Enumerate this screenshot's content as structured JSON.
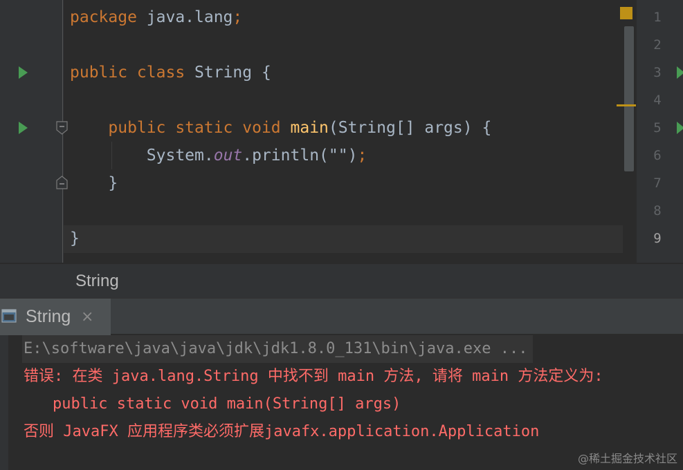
{
  "editor": {
    "lines": [
      {
        "tokens": [
          {
            "t": "package ",
            "c": "kw"
          },
          {
            "t": "java.lang",
            "c": "pl"
          },
          {
            "t": ";",
            "c": "kw"
          }
        ]
      },
      {
        "tokens": []
      },
      {
        "tokens": [
          {
            "t": "public class ",
            "c": "kw"
          },
          {
            "t": "String {",
            "c": "pl"
          }
        ]
      },
      {
        "tokens": []
      },
      {
        "tokens": [
          {
            "t": "    public static void ",
            "c": "kw"
          },
          {
            "t": "main",
            "c": "fn"
          },
          {
            "t": "(String[] args) {",
            "c": "pl"
          }
        ]
      },
      {
        "tokens": [
          {
            "t": "        System.",
            "c": "pl"
          },
          {
            "t": "out",
            "c": "fld"
          },
          {
            "t": ".println(",
            "c": "pl"
          },
          {
            "t": "\"\"",
            "c": "pl"
          },
          {
            "t": ")",
            "c": "pl"
          },
          {
            "t": ";",
            "c": "kw"
          }
        ]
      },
      {
        "tokens": [
          {
            "t": "    }",
            "c": "pl"
          }
        ]
      },
      {
        "tokens": []
      },
      {
        "tokens": [
          {
            "t": "}",
            "c": "pl"
          }
        ]
      }
    ],
    "line_numbers": [
      "1",
      "2",
      "3",
      "4",
      "5",
      "6",
      "7",
      "8",
      "9"
    ],
    "active_line": "9"
  },
  "breadcrumb": {
    "label": "String"
  },
  "run": {
    "tab_label": "String",
    "close_glyph": "×"
  },
  "console": {
    "command": "E:\\software\\java\\java\\jdk\\jdk1.8.0_131\\bin\\java.exe ...",
    "error_line_1": "错误: 在类 java.lang.String 中找不到 main 方法, 请将 main 方法定义为:",
    "error_line_2": "public static void main(String[] args)",
    "error_line_3": "否则 JavaFX 应用程序类必须扩展javafx.application.Application"
  },
  "watermark": "@稀土掘金技术社区",
  "colors": {
    "keyword": "#cc7832",
    "method": "#ffc66d",
    "field": "#9876aa",
    "plain": "#a9b7c6",
    "error": "#ff6b68",
    "run_arrow": "#499c54",
    "warning": "#be9117"
  }
}
